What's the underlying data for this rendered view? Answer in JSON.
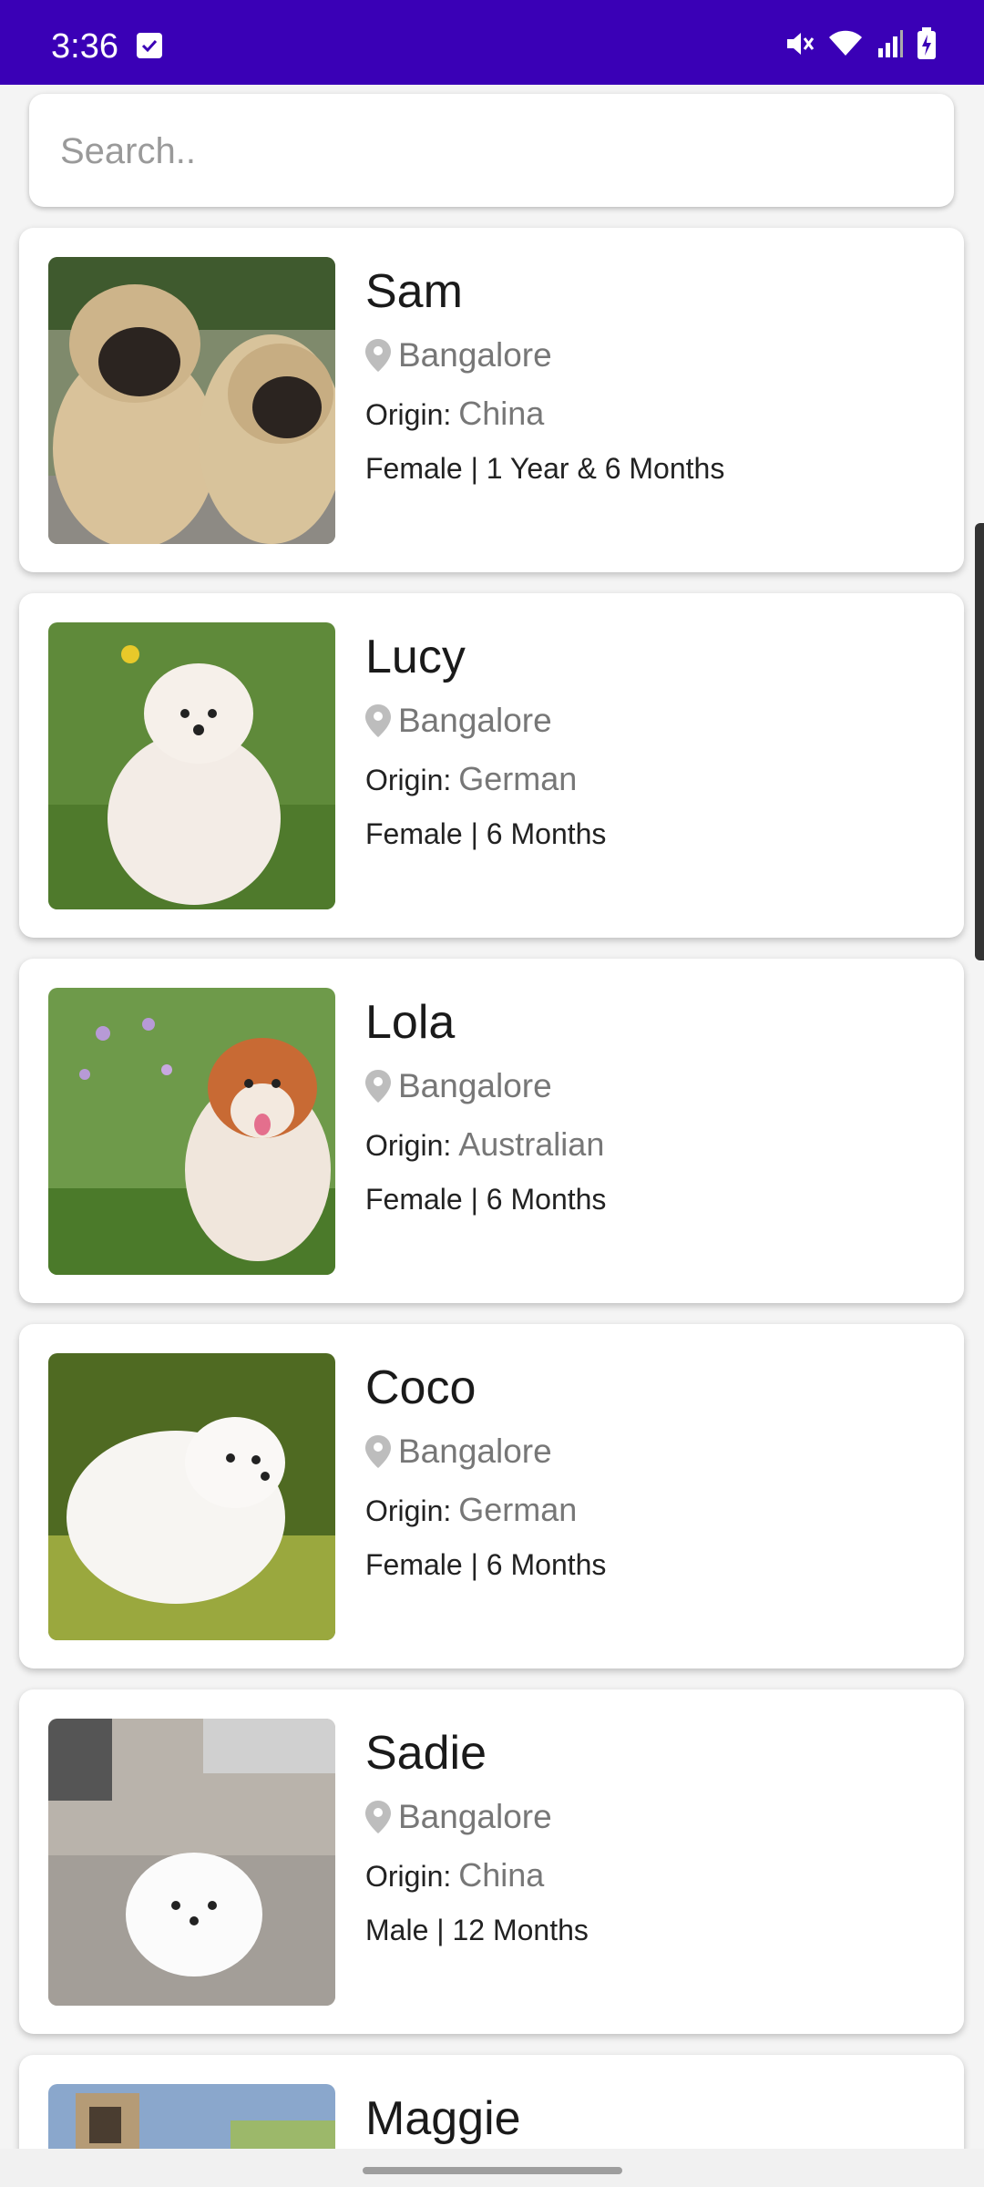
{
  "status": {
    "time": "3:36"
  },
  "search": {
    "placeholder": "Search.."
  },
  "origin_label": "Origin:",
  "pets": [
    {
      "name": "Sam",
      "location": "Bangalore",
      "origin": "China",
      "details": "Female | 1 Year & 6 Months",
      "photo": "two-pugs"
    },
    {
      "name": "Lucy",
      "location": "Bangalore",
      "origin": "German",
      "details": "Female | 6 Months",
      "photo": "white-pomeranian-grass"
    },
    {
      "name": "Lola",
      "location": "Bangalore",
      "origin": "Australian",
      "details": "Female | 6 Months",
      "photo": "orange-pomeranian-flowers"
    },
    {
      "name": "Coco",
      "location": "Bangalore",
      "origin": "German",
      "details": "Female | 6 Months",
      "photo": "white-pomeranian-moss"
    },
    {
      "name": "Sadie",
      "location": "Bangalore",
      "origin": "China",
      "details": "Male | 12 Months",
      "photo": "white-pomeranian-street"
    },
    {
      "name": "Maggie",
      "photo": "dog-house"
    }
  ]
}
